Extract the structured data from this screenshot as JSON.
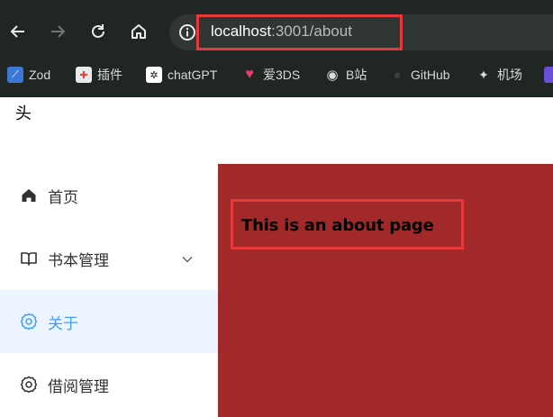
{
  "browser": {
    "url_host": "localhost",
    "url_rest": ":3001/about",
    "bookmarks": [
      {
        "label": "Zod",
        "icon": "zod-icon"
      },
      {
        "label": "插件",
        "icon": "puzzle-icon"
      },
      {
        "label": "chatGPT",
        "icon": "openai-icon"
      },
      {
        "label": "爱3DS",
        "icon": "heart-icon"
      },
      {
        "label": "B站",
        "icon": "globe-icon"
      },
      {
        "label": "GitHub",
        "icon": "github-icon"
      },
      {
        "label": "机场",
        "icon": "sparkle-icon"
      }
    ]
  },
  "header": {
    "title": "头"
  },
  "sidebar": {
    "items": [
      {
        "label": "首页",
        "icon": "home-icon"
      },
      {
        "label": "书本管理",
        "icon": "book-icon",
        "expandable": true
      },
      {
        "label": "关于",
        "icon": "gear-icon",
        "active": true
      },
      {
        "label": "借阅管理",
        "icon": "gear-icon"
      }
    ]
  },
  "main": {
    "text": "This is an about page"
  },
  "colors": {
    "content_bg": "#a2292a",
    "active_bg": "#ecf5ff",
    "active_text": "#409eff",
    "highlight": "#e6393b"
  }
}
